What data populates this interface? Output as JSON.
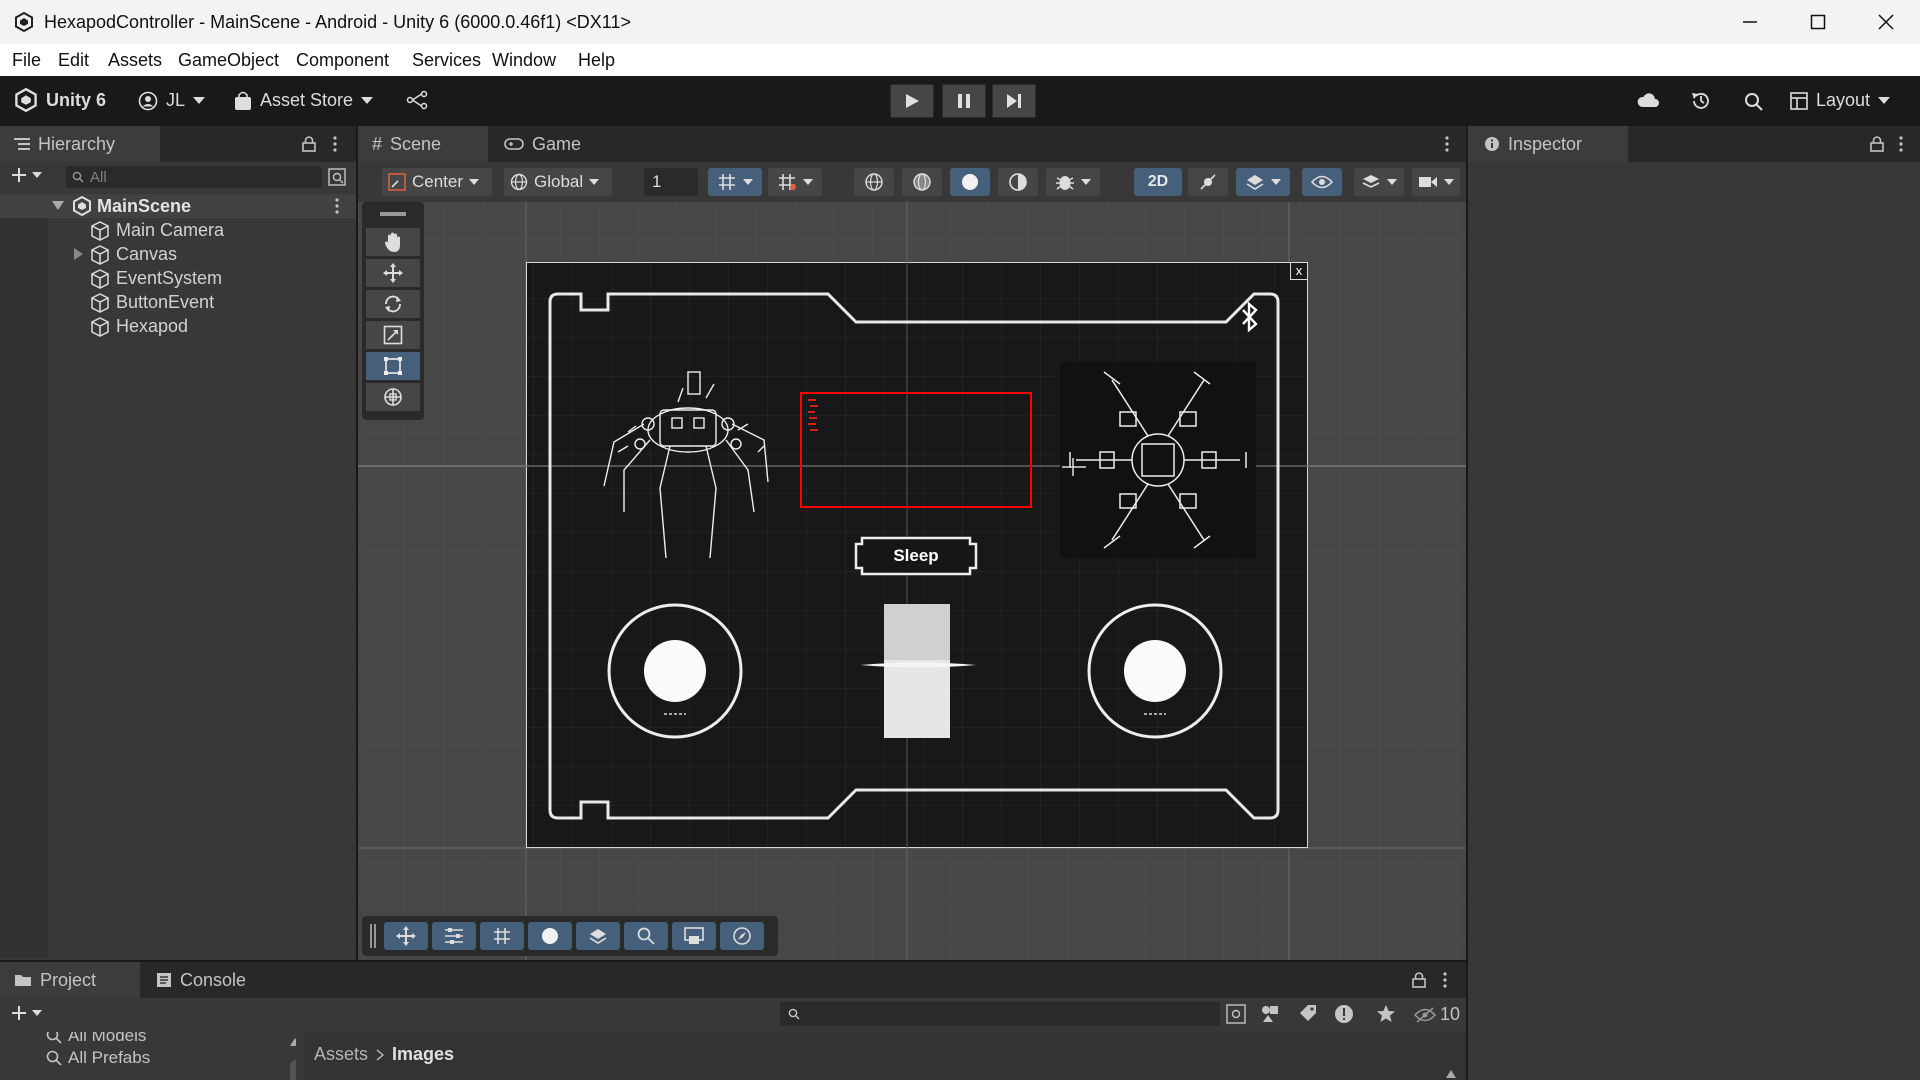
{
  "window": {
    "title": "HexapodController - MainScene - Android - Unity 6 (6000.0.46f1) <DX11>"
  },
  "menu": [
    "File",
    "Edit",
    "Assets",
    "GameObject",
    "Component",
    "Services",
    "Window",
    "Help"
  ],
  "toolbar": {
    "unity_label": "Unity 6",
    "account_label": "JL",
    "asset_store_label": "Asset Store",
    "layout_label": "Layout"
  },
  "hierarchy": {
    "tab_label": "Hierarchy",
    "search_placeholder": "All",
    "scene_name": "MainScene",
    "items": [
      "Main Camera",
      "Canvas",
      "EventSystem",
      "ButtonEvent",
      "Hexapod"
    ]
  },
  "scene": {
    "tabs": [
      "Scene",
      "Game"
    ],
    "pivot_label": "Center",
    "space_label": "Global",
    "grid_value": "1",
    "mode_2d_label": "2D",
    "ui_button_label": "Sleep",
    "close_marker": "x"
  },
  "inspector": {
    "tab_label": "Inspector"
  },
  "project": {
    "tabs": [
      "Project",
      "Console"
    ],
    "favorites": [
      "All Models",
      "All Prefabs"
    ],
    "breadcrumb": [
      "Assets",
      "Images"
    ],
    "hidden_count": "10"
  },
  "colors": {
    "editor_bg": "#383838",
    "scene_bg": "#474747",
    "accent_blue": "#46607c",
    "selection_red": "#ff0000"
  }
}
